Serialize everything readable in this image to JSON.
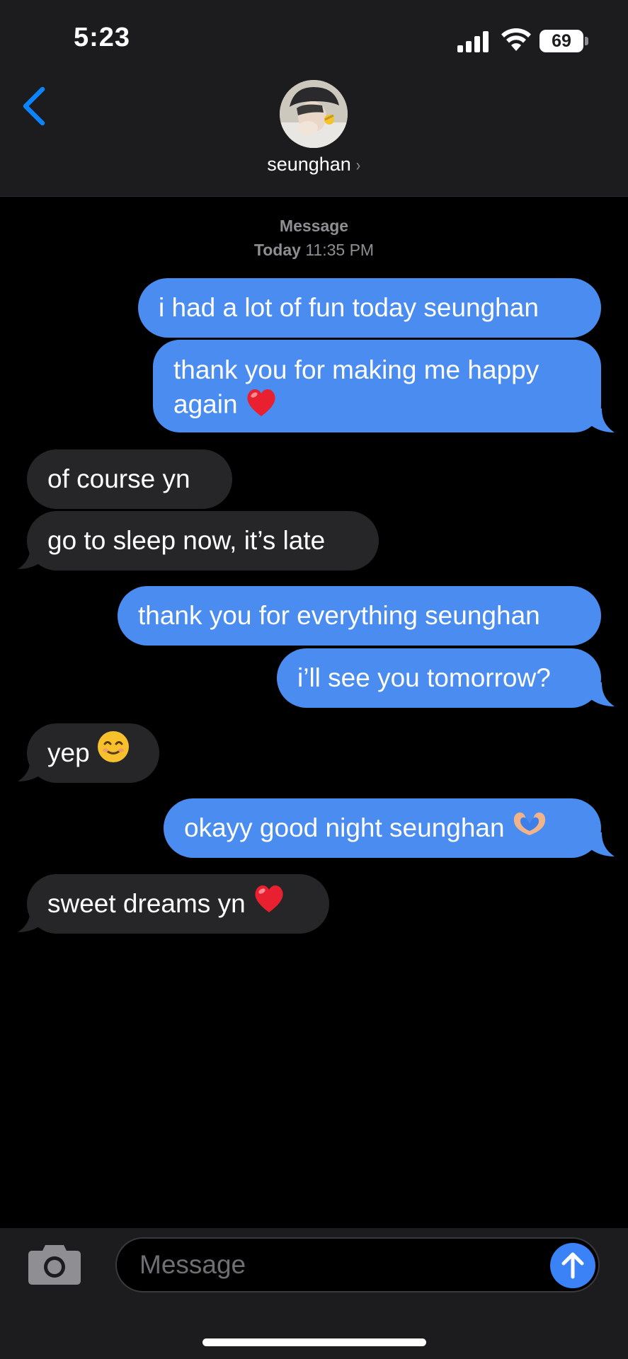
{
  "status_bar": {
    "time": "5:23",
    "battery": "69"
  },
  "contact": {
    "name": "seunghan",
    "chevron": "›"
  },
  "thread": {
    "service": "Message",
    "day": "Today",
    "time": "11:35 PM"
  },
  "messages": [
    {
      "sender": "me",
      "text": "i had a lot of fun today seunghan"
    },
    {
      "sender": "me",
      "text": "thank you for making me happy again",
      "emoji": "red-heart"
    },
    {
      "sender": "them",
      "text": "of course yn"
    },
    {
      "sender": "them",
      "text": "go to sleep now, it’s late"
    },
    {
      "sender": "me",
      "text": "thank you for everything seunghan"
    },
    {
      "sender": "me",
      "text": "i’ll see you tomorrow?"
    },
    {
      "sender": "them",
      "text": "yep",
      "emoji": "smiling-face"
    },
    {
      "sender": "me",
      "text": "okayy good night seunghan",
      "emoji": "heart-hands"
    },
    {
      "sender": "them",
      "text": "sweet dreams yn",
      "emoji": "red-heart"
    }
  ],
  "composer": {
    "placeholder": "Message"
  },
  "icons": {
    "back": "chevron-left-icon",
    "camera": "camera-icon",
    "send": "arrow-up-icon",
    "signal": "cellular-signal-icon",
    "wifi": "wifi-icon",
    "battery": "battery-icon"
  },
  "colors": {
    "outgoing_bubble": "#4a8cf0",
    "incoming_bubble": "#262628",
    "accent": "#0a84ff",
    "background": "#000000",
    "bar": "#1c1c1e"
  }
}
